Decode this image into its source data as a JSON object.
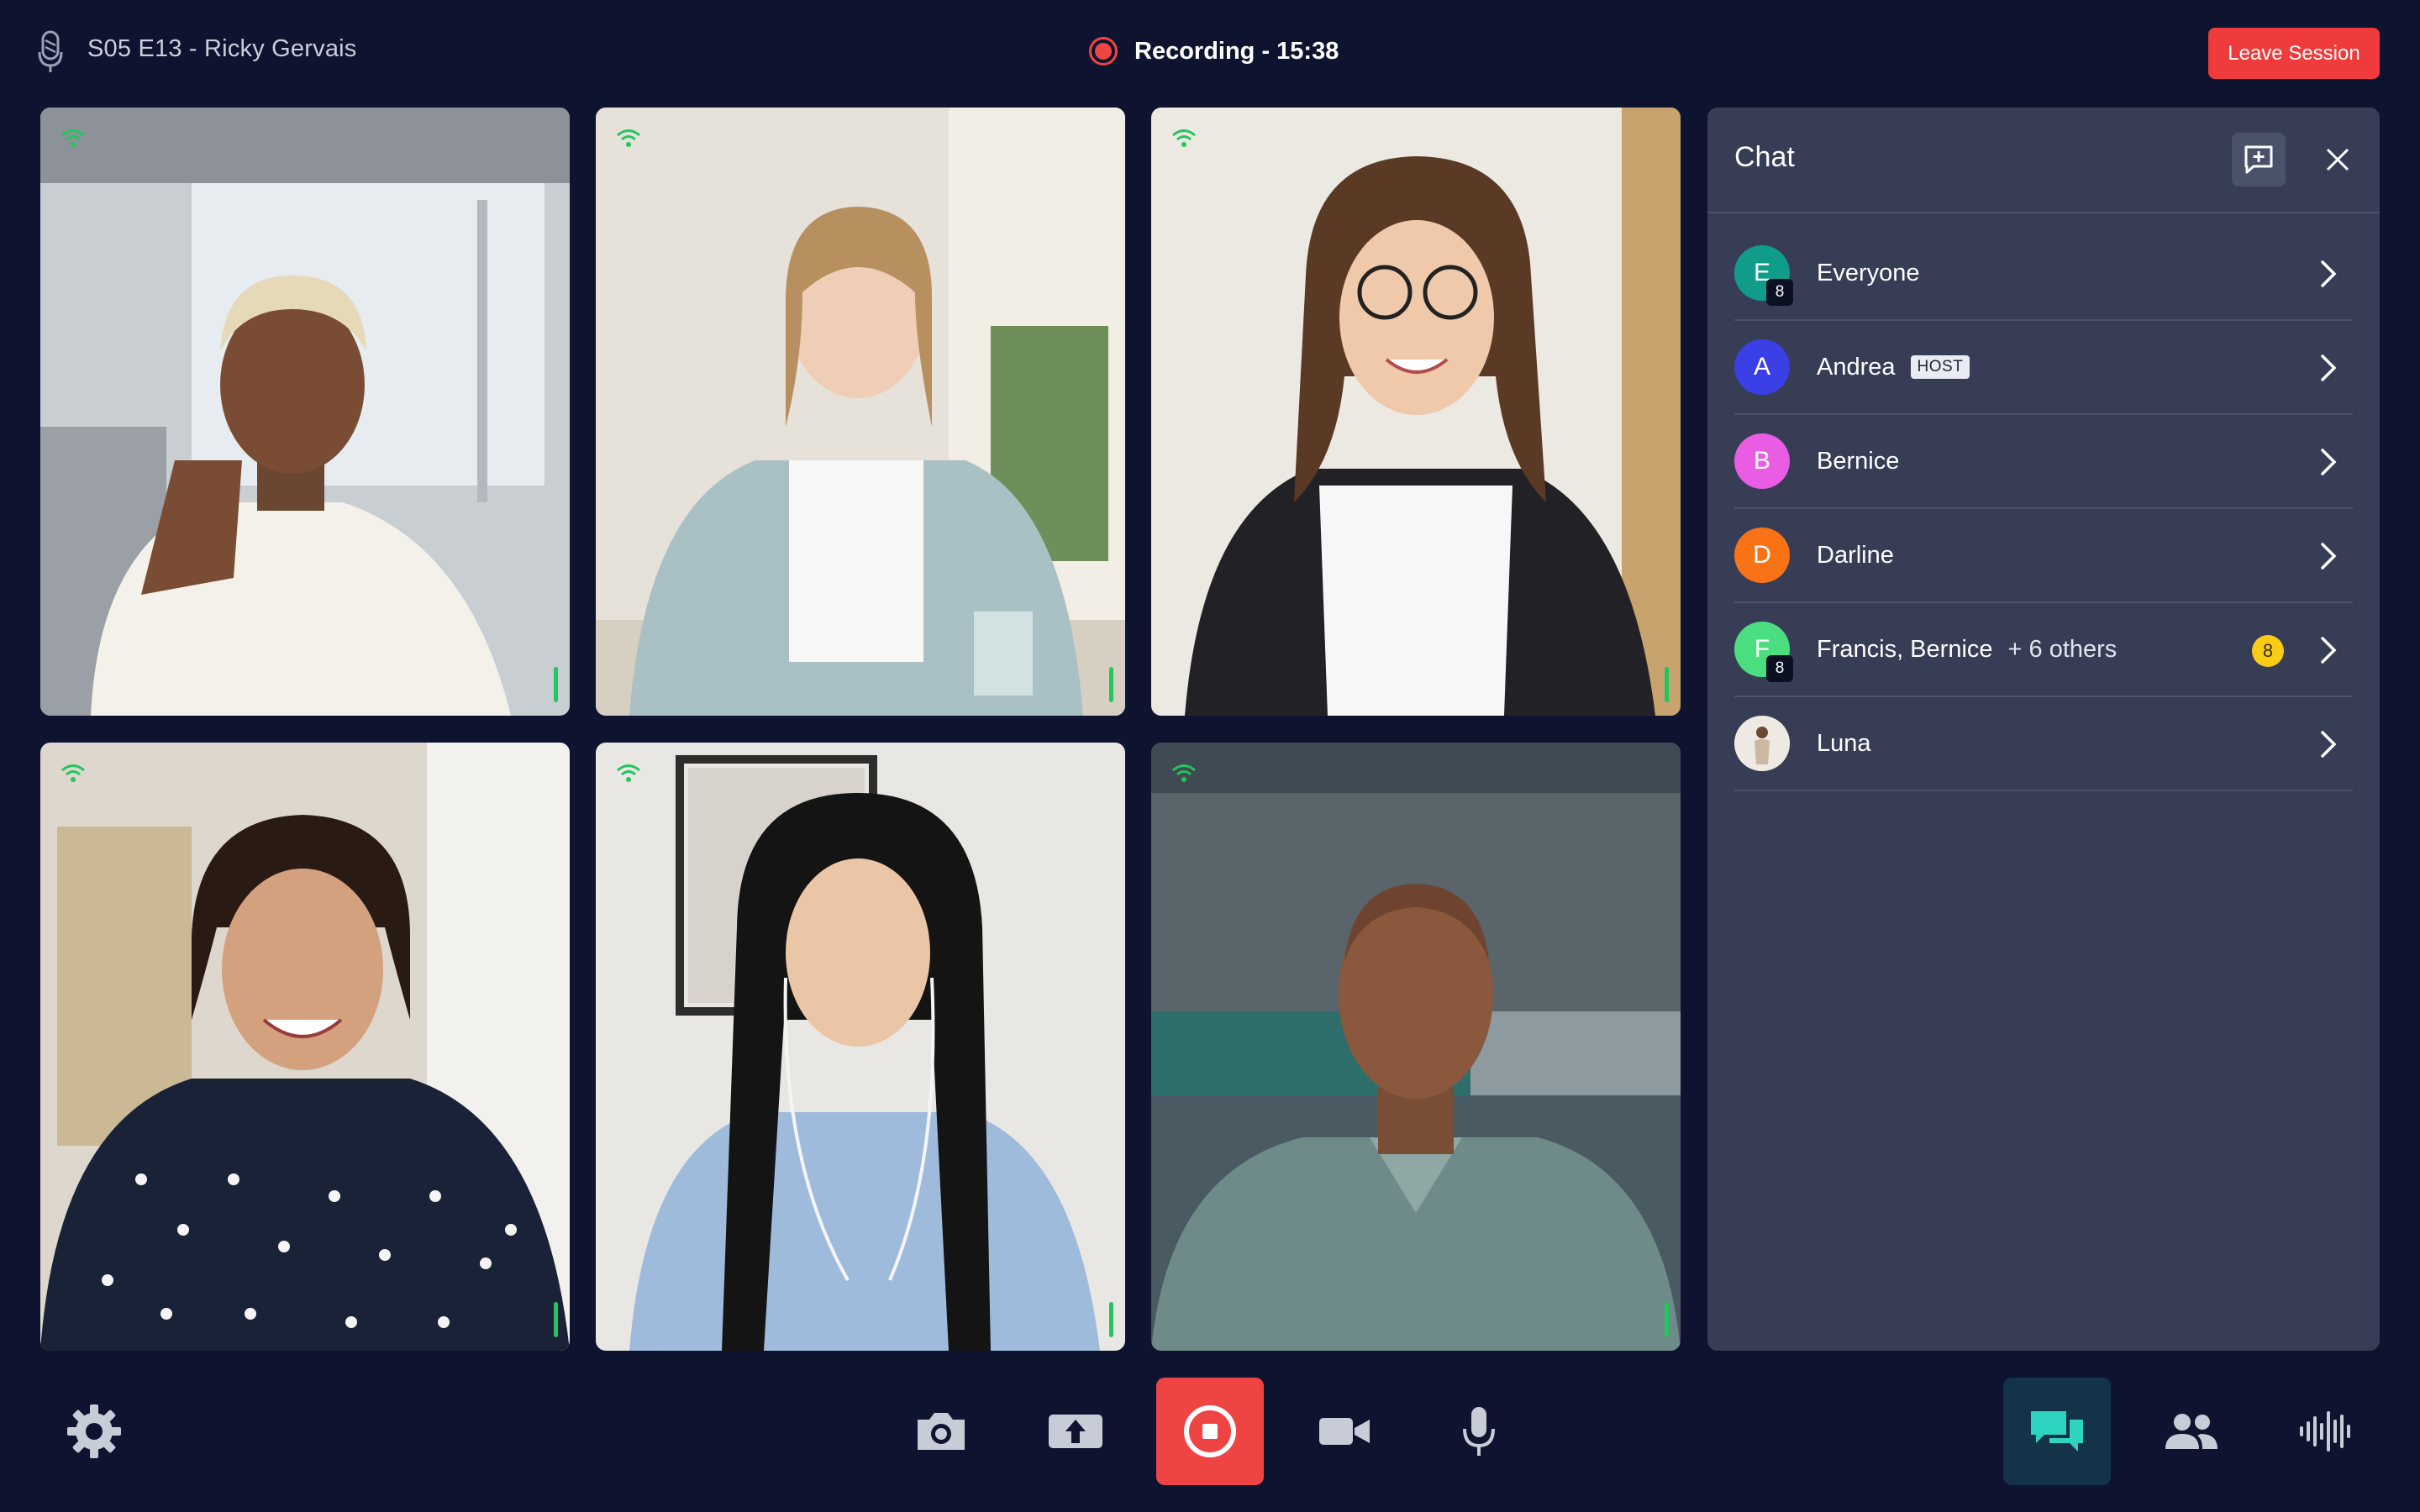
{
  "header": {
    "session_title": "S05 E13 - Ricky Gervais",
    "recording_text": "Recording - 15:38",
    "leave_label": "Leave Session"
  },
  "tiles": [
    {
      "name": "participant-1",
      "signal": "wifi-icon"
    },
    {
      "name": "participant-2",
      "signal": "wifi-icon"
    },
    {
      "name": "participant-3",
      "signal": "wifi-icon"
    },
    {
      "name": "participant-4",
      "signal": "wifi-icon"
    },
    {
      "name": "participant-5",
      "signal": "wifi-icon"
    },
    {
      "name": "participant-6",
      "signal": "wifi-icon"
    }
  ],
  "chat": {
    "title": "Chat",
    "rows": [
      {
        "initial": "E",
        "name": "Everyone",
        "count": "8",
        "color": "#0f9d8a"
      },
      {
        "initial": "A",
        "name": "Andrea",
        "badge": "HOST",
        "color": "#3b3fe6"
      },
      {
        "initial": "B",
        "name": "Bernice",
        "color": "#e85de3"
      },
      {
        "initial": "D",
        "name": "Darline",
        "color": "#f97316"
      },
      {
        "initial": "F",
        "name": "Francis, Bernice",
        "extra": "+ 6 others",
        "count": "8",
        "unread": "8",
        "color": "#4ade80"
      },
      {
        "initial": "",
        "name": "Luna",
        "color": "#e7e2da"
      }
    ]
  },
  "toolbar": {
    "left": [
      "settings-icon"
    ],
    "center": [
      "camera-icon",
      "share-screen-icon",
      "stop-recording-icon",
      "video-icon",
      "microphone-icon"
    ],
    "right": [
      "chat-icon",
      "participants-icon",
      "audio-wave-icon"
    ]
  },
  "colors": {
    "background": "#0e1430",
    "panel": "#363d55",
    "accent_red": "#ef4444",
    "signal_green": "#22c55e",
    "unread_yellow": "#facc15"
  }
}
